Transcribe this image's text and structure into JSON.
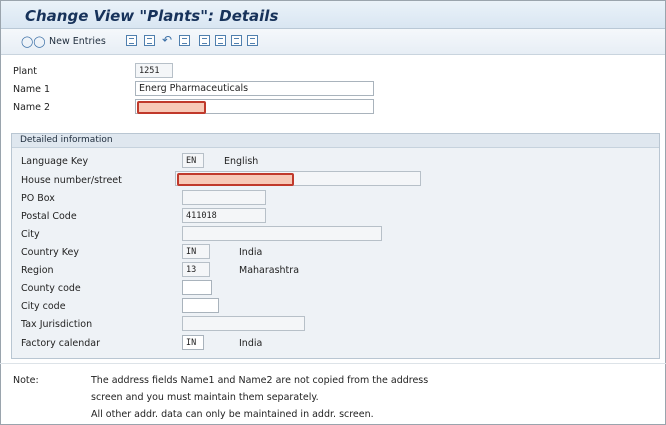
{
  "title": "Change View \"Plants\": Details",
  "toolbar": {
    "new_entries": "New Entries"
  },
  "plant": {
    "label": "Plant",
    "value": "1251"
  },
  "name1": {
    "label": "Name 1",
    "value": "Energ Pharmaceuticals"
  },
  "name2": {
    "label": "Name 2",
    "value": ""
  },
  "detail": {
    "title": "Detailed information",
    "language_key": {
      "label": "Language Key",
      "value": "EN",
      "text": "English"
    },
    "house_number": {
      "label": "House number/street",
      "value": ""
    },
    "po_box": {
      "label": "PO Box",
      "value": ""
    },
    "postal_code": {
      "label": "Postal Code",
      "value": "411018"
    },
    "city": {
      "label": "City",
      "value": ""
    },
    "country_key": {
      "label": "Country Key",
      "value": "IN",
      "text": "India"
    },
    "region": {
      "label": "Region",
      "value": "13",
      "text": "Maharashtra"
    },
    "county_code": {
      "label": "County code",
      "value": ""
    },
    "city_code": {
      "label": "City code",
      "value": ""
    },
    "tax_jurisdiction": {
      "label": "Tax Jurisdiction",
      "value": ""
    },
    "factory_calendar": {
      "label": "Factory calendar",
      "value": "IN",
      "text": "India"
    }
  },
  "note": {
    "label": "Note:",
    "line1": "The address fields Name1 and Name2 are not copied from the address",
    "line2": "screen and you must maintain them separately.",
    "line3": "All other addr. data can only be maintained in addr. screen."
  },
  "colors": {
    "highlight_border": "#c0392b",
    "highlight_fill": "#f7c9b7",
    "title": "#17325a"
  }
}
